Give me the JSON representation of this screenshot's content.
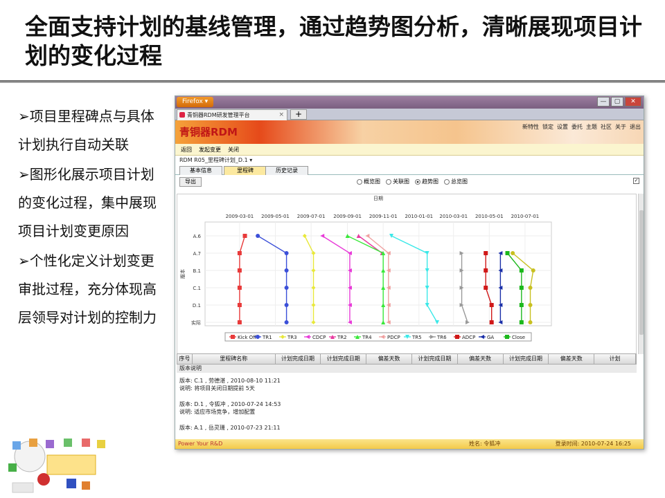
{
  "slide": {
    "title": "全面支持计划的基线管理，通过趋势图分析，清晰展现项目计划的变化过程",
    "bullets": [
      "项目里程碑点与具体计划执行自动关联",
      "图形化展示项目计划的变化过程，集中展现项目计划变更原因",
      "个性化定义计划变更审批过程，充分体现高层领导对计划的控制力"
    ]
  },
  "browser": {
    "menu_button": "Firefox ▾",
    "tab_title": "青铜器RDM研发管理平台",
    "new_tab": "+",
    "window_buttons": [
      "—",
      "▢",
      "✕"
    ]
  },
  "app": {
    "logo": "青铜器RDM",
    "top_menu": [
      "新特性",
      "锁定",
      "设置",
      "委托",
      "主题",
      "社区",
      "关于",
      "退出"
    ],
    "actions": [
      "返回",
      "发起变更",
      "关闭"
    ],
    "plan_select": "RDM R05_里程碑计划_D.1",
    "subtabs": [
      "基本信息",
      "里程碑",
      "历史记录"
    ],
    "export_button": "导出",
    "radios": [
      {
        "label": "概览图",
        "checked": false
      },
      {
        "label": "关联图",
        "checked": false
      },
      {
        "label": "趋势图",
        "checked": true
      },
      {
        "label": "总览图",
        "checked": false
      }
    ],
    "checkbox_mark": "✓"
  },
  "chart_data": {
    "type": "line",
    "xlabel": "日期",
    "ylabel": "版本",
    "x_ticks": [
      "2009-03-01",
      "2009-05-01",
      "2009-07-01",
      "2009-09-01",
      "2009-11-01",
      "2010-01-01",
      "2010-03-01",
      "2010-05-01",
      "2010-07-01"
    ],
    "xlim": [
      "2009-01-01",
      "2010-08-15"
    ],
    "categories": [
      "A.6",
      "A.7",
      "B.1",
      "C.1",
      "D.1",
      "实际"
    ],
    "series": [
      {
        "name": "Kick Off",
        "color": "#e83a3a",
        "marker": "square",
        "points": [
          [
            "2009-03-10",
            "A.6"
          ],
          [
            "2009-03-01",
            "A.7"
          ],
          [
            "2009-03-01",
            "B.1"
          ],
          [
            "2009-03-01",
            "C.1"
          ],
          [
            "2009-03-01",
            "D.1"
          ],
          [
            "2009-03-01",
            "实际"
          ]
        ]
      },
      {
        "name": "TR1",
        "color": "#3b4fd8",
        "marker": "circle",
        "points": [
          [
            "2009-04-01",
            "A.6"
          ],
          [
            "2009-05-20",
            "A.7"
          ],
          [
            "2009-05-20",
            "B.1"
          ],
          [
            "2009-05-20",
            "C.1"
          ],
          [
            "2009-05-20",
            "D.1"
          ],
          [
            "2009-05-20",
            "实际"
          ]
        ]
      },
      {
        "name": "TR3",
        "color": "#e8e83a",
        "marker": "diamond",
        "points": [
          [
            "2009-06-20",
            "A.6"
          ],
          [
            "2009-07-05",
            "A.7"
          ],
          [
            "2009-07-05",
            "B.1"
          ],
          [
            "2009-07-05",
            "C.1"
          ],
          [
            "2009-07-05",
            "D.1"
          ],
          [
            "2009-07-05",
            "实际"
          ]
        ]
      },
      {
        "name": "CDCP",
        "color": "#e83ad8",
        "marker": "triangle-left",
        "points": [
          [
            "2009-07-20",
            "A.6"
          ],
          [
            "2009-09-05",
            "A.7"
          ],
          [
            "2009-09-05",
            "B.1"
          ],
          [
            "2009-09-05",
            "C.1"
          ],
          [
            "2009-09-05",
            "D.1"
          ],
          [
            "2009-09-05",
            "实际"
          ]
        ]
      },
      {
        "name": "TR2",
        "color": "#e83aa0",
        "marker": "triangle-up",
        "points": [
          [
            "2009-09-20",
            "A.6"
          ],
          [
            "2009-10-30",
            "A.7"
          ]
        ]
      },
      {
        "name": "TR4",
        "color": "#3ae83a",
        "marker": "triangle-up",
        "points": [
          [
            "2009-09-01",
            "A.6"
          ],
          [
            "2009-11-01",
            "A.7"
          ],
          [
            "2009-11-01",
            "B.1"
          ],
          [
            "2009-11-01",
            "C.1"
          ],
          [
            "2009-11-01",
            "D.1"
          ],
          [
            "2009-11-01",
            "实际"
          ]
        ]
      },
      {
        "name": "PDCP",
        "color": "#f0a0a0",
        "marker": "triangle-left",
        "points": [
          [
            "2009-10-05",
            "A.6"
          ],
          [
            "2009-11-10",
            "A.7"
          ],
          [
            "2009-11-10",
            "B.1"
          ],
          [
            "2009-11-10",
            "C.1"
          ],
          [
            "2009-11-10",
            "D.1"
          ],
          [
            "2009-11-10",
            "实际"
          ]
        ]
      },
      {
        "name": "TR5",
        "color": "#3ae8e8",
        "marker": "triangle-down",
        "points": [
          [
            "2009-11-15",
            "A.6"
          ],
          [
            "2010-01-15",
            "A.7"
          ],
          [
            "2010-01-15",
            "B.1"
          ],
          [
            "2010-01-15",
            "C.1"
          ],
          [
            "2010-01-15",
            "D.1"
          ],
          [
            "2010-02-01",
            "实际"
          ]
        ]
      },
      {
        "name": "TR6",
        "color": "#999999",
        "marker": "triangle-right",
        "points": [
          [
            "2010-03-15",
            "A.7"
          ],
          [
            "2010-03-15",
            "B.1"
          ],
          [
            "2010-03-15",
            "C.1"
          ],
          [
            "2010-03-15",
            "D.1"
          ],
          [
            "2010-03-25",
            "实际"
          ]
        ]
      },
      {
        "name": "ADCP",
        "color": "#d01818",
        "marker": "square",
        "points": [
          [
            "2010-04-25",
            "A.7"
          ],
          [
            "2010-04-25",
            "B.1"
          ],
          [
            "2010-04-25",
            "C.1"
          ],
          [
            "2010-05-05",
            "D.1"
          ],
          [
            "2010-05-05",
            "实际"
          ]
        ]
      },
      {
        "name": "GA",
        "color": "#1a2fa8",
        "marker": "triangle-left",
        "points": [
          [
            "2010-05-20",
            "A.7"
          ],
          [
            "2010-05-20",
            "B.1"
          ],
          [
            "2010-05-20",
            "C.1"
          ],
          [
            "2010-05-20",
            "D.1"
          ],
          [
            "2010-05-20",
            "实际"
          ]
        ]
      },
      {
        "name": "Close",
        "color": "#1cb81c",
        "marker": "square",
        "points": [
          [
            "2010-06-01",
            "A.7"
          ],
          [
            "2010-06-25",
            "B.1"
          ],
          [
            "2010-06-25",
            "C.1"
          ],
          [
            "2010-06-25",
            "D.1"
          ],
          [
            "2010-06-25",
            "实际"
          ]
        ]
      },
      {
        "name": "",
        "color": "#c8c020",
        "marker": "circle",
        "points": [
          [
            "2010-06-10",
            "A.7"
          ],
          [
            "2010-07-15",
            "B.1"
          ],
          [
            "2010-07-10",
            "C.1"
          ],
          [
            "2010-07-10",
            "D.1"
          ],
          [
            "2010-07-10",
            "实际"
          ]
        ]
      }
    ],
    "legend_position": "bottom"
  },
  "grid": {
    "columns": [
      "序号",
      "里程碑名称",
      "计划完成日期",
      "计划完成日期",
      "偏差天数",
      "计划完成日期",
      "偏差天数",
      "计划完成日期",
      "偏差天数",
      "计划"
    ]
  },
  "notes": {
    "section": "版本说明",
    "entries": [
      {
        "version": "版本: C.1 , 劳德湛 , 2010-08-10 11:21",
        "desc": "说明: 将项目关闭日期提前 5天"
      },
      {
        "version": "版本: D.1 , 令狐冲 , 2010-07-24 14:53",
        "desc": "说明: 适应市场竞争，增加配置"
      },
      {
        "version": "版本: A.1 , 岳灵珊 , 2010-07-23 21:11",
        "desc": ""
      }
    ]
  },
  "status": {
    "left": "Power Your R&D",
    "user": "姓名: 令狐冲",
    "login": "登录时间: 2010-07-24 16:25"
  }
}
